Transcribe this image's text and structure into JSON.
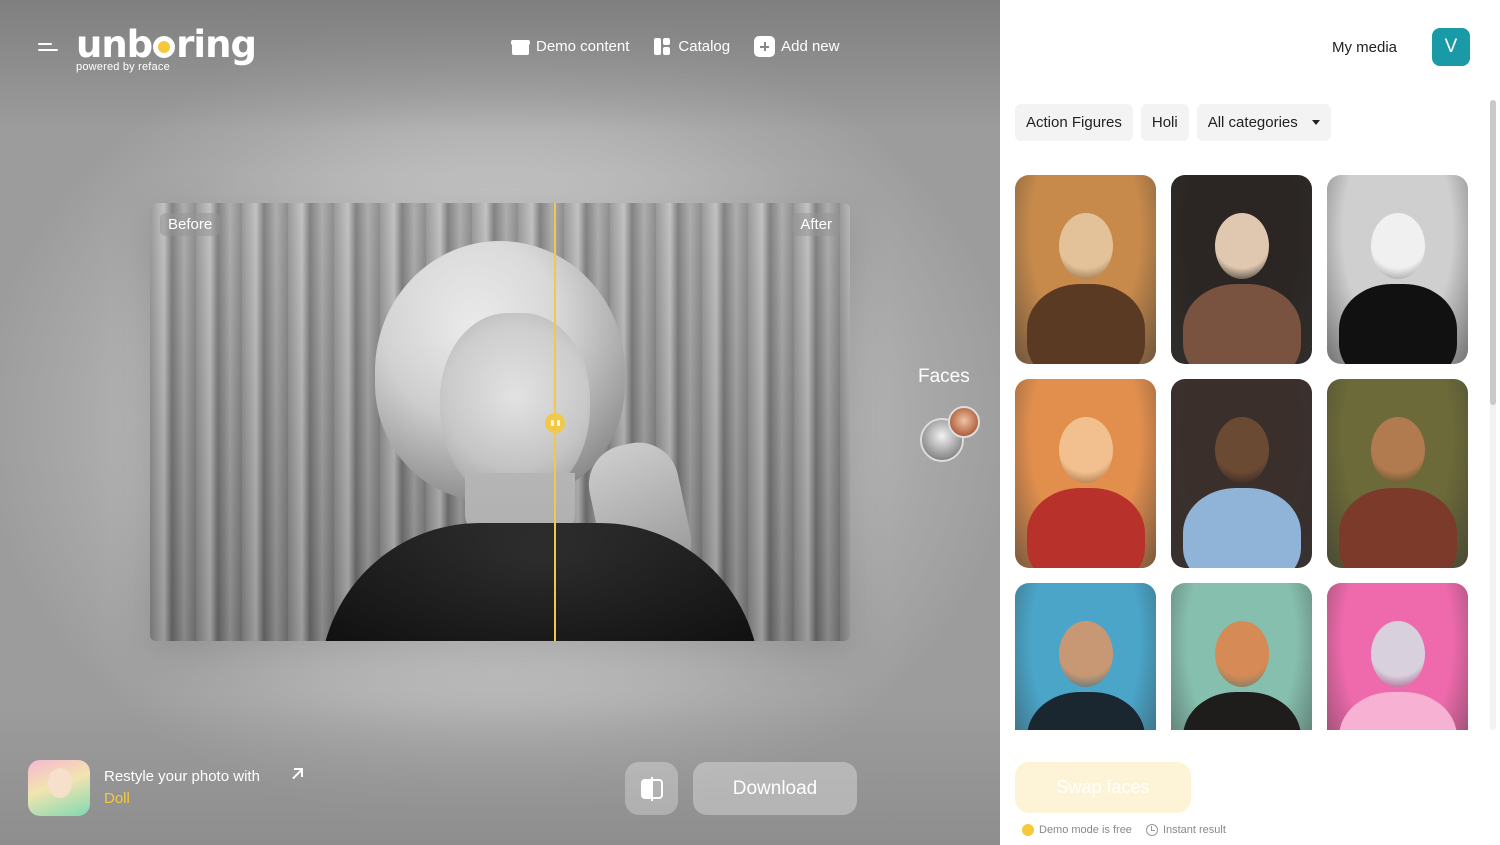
{
  "brand": {
    "logo": "unboring",
    "tagline": "powered by reface",
    "accent": "#f6c93a"
  },
  "topnav": [
    {
      "label": "Demo content",
      "icon": "gift-icon"
    },
    {
      "label": "Catalog",
      "icon": "catalog-icon"
    },
    {
      "label": "Add new",
      "icon": "plus-icon"
    }
  ],
  "compare": {
    "before_label": "Before",
    "after_label": "After"
  },
  "faces": {
    "title": "Faces"
  },
  "restyle": {
    "text": "Restyle your photo with",
    "link": "Doll"
  },
  "actions": {
    "download_label": "Download"
  },
  "panel": {
    "my_media": "My media",
    "avatar_letter": "V",
    "avatar_color": "#1a9aa6",
    "chips": [
      "Action Figures",
      "Holi"
    ],
    "category_select": "All categories",
    "swap_label": "Swap faces",
    "notes": [
      "Demo mode is free",
      "Instant result"
    ]
  },
  "templates": [
    {
      "name": "scholar-with-books",
      "colors": [
        "#c78a4b",
        "#5a3a22",
        "#e3c29a"
      ]
    },
    {
      "name": "woman-in-saree",
      "colors": [
        "#2b2623",
        "#7a5240",
        "#e0c8b0"
      ]
    },
    {
      "name": "monroe-bw",
      "colors": [
        "#cfcfcf",
        "#111111",
        "#f0f0f0"
      ]
    },
    {
      "name": "holi-festival",
      "colors": [
        "#e28f4e",
        "#b8322b",
        "#f2c08e"
      ]
    },
    {
      "name": "flight-attendant",
      "colors": [
        "#3b2f2c",
        "#8fb4d8",
        "#6b4a34"
      ]
    },
    {
      "name": "man-with-turban",
      "colors": [
        "#6c6a38",
        "#7b3a2a",
        "#b27a4f"
      ]
    },
    {
      "name": "surfer",
      "colors": [
        "#4aa5c9",
        "#1b2730",
        "#c89874"
      ]
    },
    {
      "name": "man-with-flowers",
      "colors": [
        "#86bfae",
        "#1f1c1c",
        "#d68a56"
      ]
    },
    {
      "name": "pink-robot",
      "colors": [
        "#ef6aac",
        "#f7b1d3",
        "#d9d0de"
      ]
    }
  ]
}
